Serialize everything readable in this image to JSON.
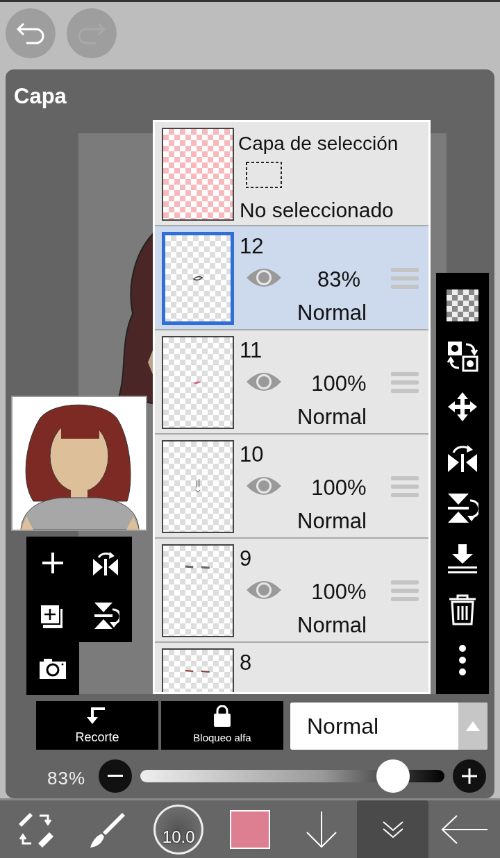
{
  "history": [
    {
      "kind": "undo",
      "disabled": false
    },
    {
      "kind": "redo",
      "disabled": true
    }
  ],
  "panel": {
    "title": "Capa"
  },
  "selection_layer": {
    "title": "Capa de selección",
    "status": "No seleccionado"
  },
  "layers": [
    {
      "number": "12",
      "opacity": "83%",
      "blend": "Normal",
      "visible": true,
      "selected": true
    },
    {
      "number": "11",
      "opacity": "100%",
      "blend": "Normal",
      "visible": true,
      "selected": false
    },
    {
      "number": "10",
      "opacity": "100%",
      "blend": "Normal",
      "visible": true,
      "selected": false
    },
    {
      "number": "9",
      "opacity": "100%",
      "blend": "Normal",
      "visible": true,
      "selected": false
    },
    {
      "number": "8",
      "selected": false
    }
  ],
  "layer_buttons": [
    {
      "kind": "clip",
      "label": "Recorte"
    },
    {
      "kind": "alpha",
      "label": "Bloqueo alfa"
    }
  ],
  "blend_mode": {
    "value": "Normal"
  },
  "opacity": {
    "reading": "83%",
    "level": 0.83
  },
  "bottom_tools": [
    {
      "kind": "swap",
      "selected": false
    },
    {
      "kind": "brush",
      "selected": false
    },
    {
      "kind": "size",
      "label": "10.0",
      "selected": false
    },
    {
      "kind": "color",
      "color": "#dd7f90",
      "selected": false
    },
    {
      "kind": "down",
      "selected": false
    },
    {
      "kind": "collapse",
      "selected": true
    },
    {
      "kind": "back",
      "selected": false
    }
  ]
}
